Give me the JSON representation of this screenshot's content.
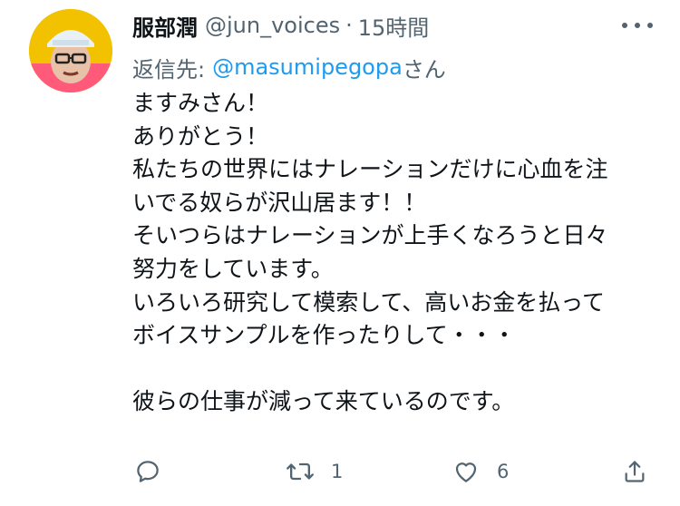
{
  "tweet": {
    "author_name": "服部潤",
    "handle": "@jun_voices",
    "separator": "·",
    "timestamp": "15時間",
    "reply_prefix": "返信先:",
    "reply_mention": "@masumipegopa",
    "reply_suffix": "さん",
    "body_lines": [
      "ますみさん！",
      "ありがとう！",
      "私たちの世界にはナレーションだけに心血を注",
      "いでる奴らが沢山居ます！！",
      "そいつらはナレーションが上手くなろうと日々",
      "努力をしています。",
      "いろいろ研究して模索して、高いお金を払って",
      "ボイスサンプルを作ったりして・・・",
      "",
      "彼らの仕事が減って来ているのです。"
    ],
    "retweet_count": "1",
    "like_count": "6",
    "icons": {
      "avatar": "avatar",
      "more": "more-dots-icon",
      "reply": "reply-icon",
      "retweet": "retweet-icon",
      "like": "heart-icon",
      "share": "share-icon"
    }
  }
}
